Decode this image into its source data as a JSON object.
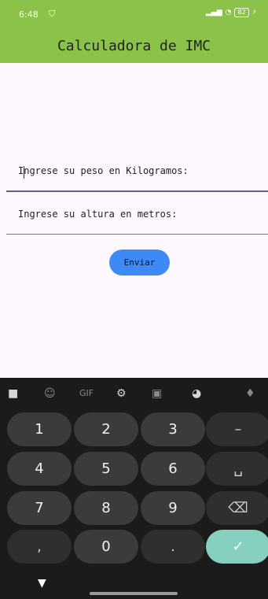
{
  "status_bar": {
    "time": "6:48",
    "battery": "82"
  },
  "app_bar": {
    "title": "Calculadora de IMC",
    "color": "#8bc34a"
  },
  "form": {
    "weight_placeholder": "Ingrese su peso en Kilogramos:",
    "height_placeholder": "Ingrese su altura en metros:",
    "submit_label": "Enviar"
  },
  "keyboard": {
    "toolbar": {
      "gif_label": "GIF"
    },
    "rows": [
      [
        "1",
        "2",
        "3",
        "–"
      ],
      [
        "4",
        "5",
        "6",
        "␣"
      ],
      [
        "7",
        "8",
        "9",
        "⌫"
      ],
      [
        ",",
        "0",
        ".",
        "✓"
      ]
    ],
    "accent_color": "#86d0c0"
  }
}
